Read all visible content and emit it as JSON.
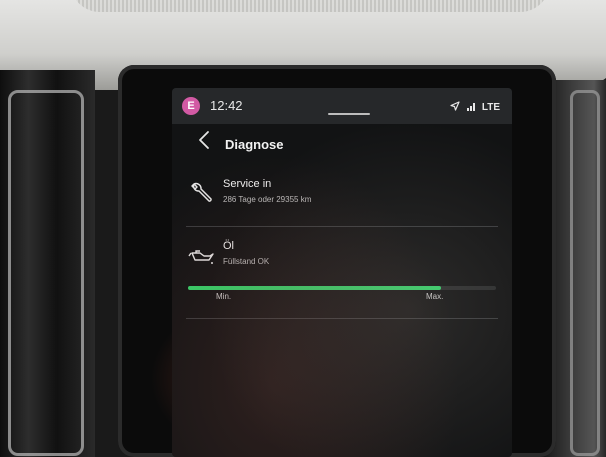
{
  "status_bar": {
    "avatar_letter": "E",
    "time": "12:42",
    "network": "LTE",
    "icons": [
      "navigation-arrow-icon",
      "signal-bars-icon"
    ]
  },
  "header": {
    "title": "Diagnose",
    "back_icon": "chevron-left-icon"
  },
  "service": {
    "icon": "wrench-icon",
    "title": "Service in",
    "detail": "286 Tage oder 29355 km"
  },
  "oil": {
    "icon": "oil-can-icon",
    "title": "Öl",
    "status": "Füllstand OK",
    "level_fraction": 0.82,
    "min_label": "Min.",
    "max_label": "Max."
  },
  "colors": {
    "accent_green": "#34d46a",
    "avatar_pink": "#d25aa4",
    "screen_bg": "#121314"
  }
}
